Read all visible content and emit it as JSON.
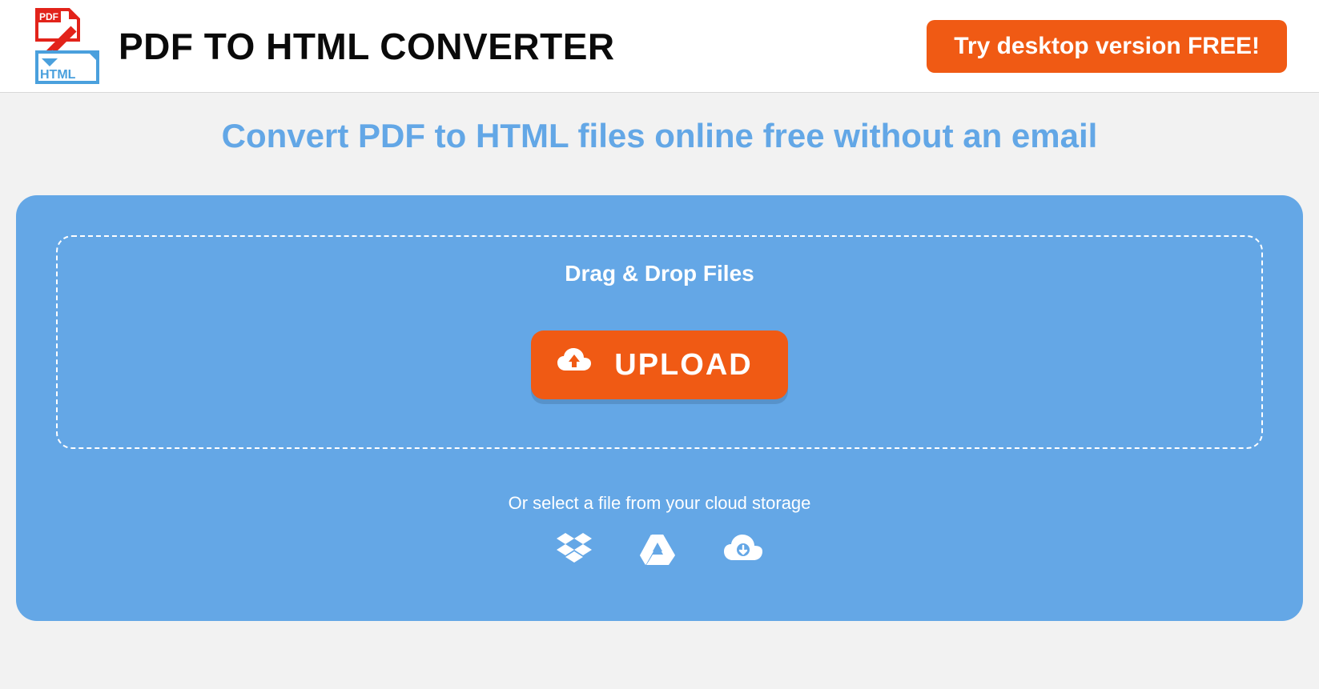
{
  "header": {
    "title": "PDF TO HTML CONVERTER",
    "cta_label": "Try desktop version FREE!"
  },
  "main": {
    "subtitle": "Convert PDF to HTML files online free without an email",
    "dropzone_label": "Drag & Drop Files",
    "upload_label": "UPLOAD",
    "cloud_label": "Or select a file from your cloud storage"
  },
  "colors": {
    "accent": "#f05a14",
    "panel": "#64a7e6",
    "subtitle": "#63a7e6"
  }
}
